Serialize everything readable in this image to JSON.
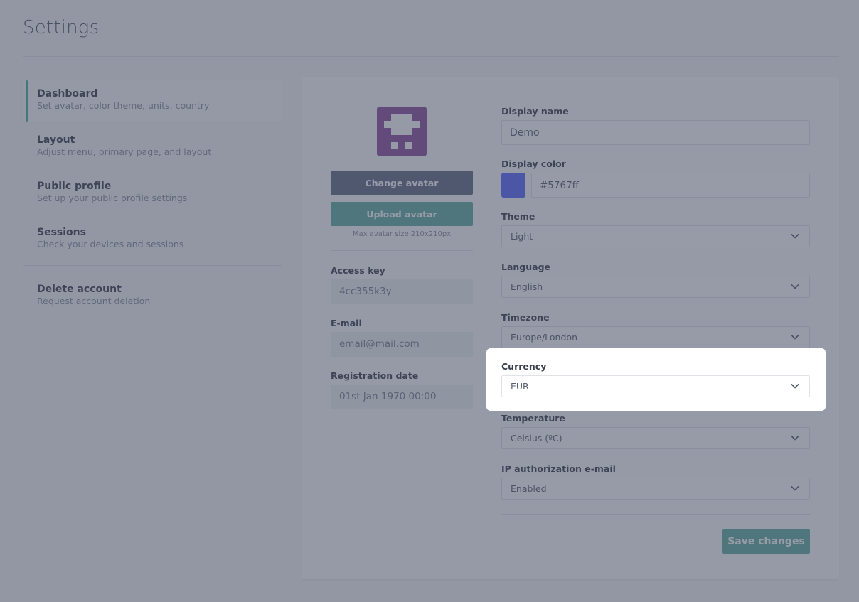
{
  "page": {
    "title": "Settings"
  },
  "sidebar": {
    "items": [
      {
        "label": "Dashboard",
        "description": "Set avatar, color theme, units, country",
        "active": true
      },
      {
        "label": "Layout",
        "description": "Adjust menu, primary page, and layout"
      },
      {
        "label": "Public profile",
        "description": "Set up your public profile settings"
      },
      {
        "label": "Sessions",
        "description": "Check your devices and sessions"
      }
    ],
    "danger_item": {
      "label": "Delete account",
      "description": "Request account deletion"
    }
  },
  "profile": {
    "avatar_icon": "pixel-avatar-icon",
    "avatar_color": "#8a4e9e",
    "change_avatar_label": "Change avatar",
    "upload_avatar_label": "Upload avatar",
    "avatar_hint": "Max avatar size 210x210px",
    "access_key": {
      "label": "Access key",
      "value": "4cc355k3y"
    },
    "email": {
      "label": "E-mail",
      "value": "email@mail.com"
    },
    "registration_date": {
      "label": "Registration date",
      "value": "01st Jan 1970 00:00"
    }
  },
  "form": {
    "display_name": {
      "label": "Display name",
      "value": "Demo"
    },
    "display_color": {
      "label": "Display color",
      "value": "#5767ff",
      "swatch": "#5767ff"
    },
    "theme": {
      "label": "Theme",
      "value": "Light"
    },
    "language": {
      "label": "Language",
      "value": "English"
    },
    "timezone": {
      "label": "Timezone",
      "value": "Europe/London"
    },
    "currency": {
      "label": "Currency",
      "value": "EUR"
    },
    "temperature": {
      "label": "Temperature",
      "value": "Celsius (ºC)"
    },
    "ip_auth": {
      "label": "IP authorization e-mail",
      "value": "Enabled"
    },
    "save_label": "Save changes"
  },
  "colors": {
    "accent": "#4fae96",
    "button_dark": "#636a85",
    "button_green": "#61aea0"
  },
  "tour": {
    "highlighted_field": "Currency"
  }
}
